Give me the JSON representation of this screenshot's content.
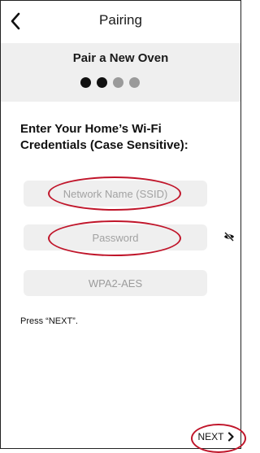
{
  "header": {
    "title": "Pairing"
  },
  "stepper": {
    "title": "Pair a New Oven",
    "steps_total": 4,
    "steps_completed": 2
  },
  "form": {
    "heading_line1": "Enter Your Home’s Wi-Fi",
    "heading_line2": "Credentials (Case Sensitive):",
    "ssid_placeholder": "Network Name (SSID)",
    "password_placeholder": "Password",
    "security_value": "WPA2-AES"
  },
  "hint": "Press “NEXT”.",
  "footer": {
    "next_label": "NEXT"
  },
  "colors": {
    "highlight": "#c0152a",
    "dot_active": "#111111",
    "dot_inactive": "#9a9a9a",
    "panel": "#efefef"
  },
  "icons": {
    "back": "chevron-left-icon",
    "visibility": "eye-slash-icon",
    "next": "chevron-right-icon"
  }
}
